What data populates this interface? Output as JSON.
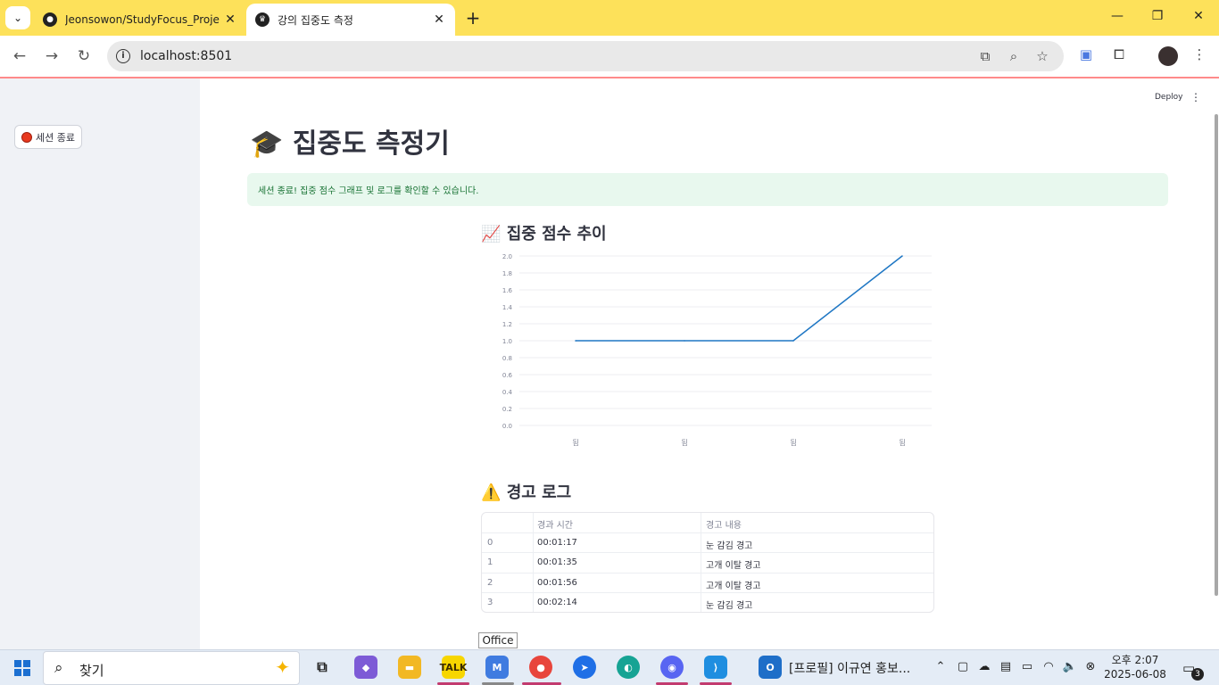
{
  "browser": {
    "tabs": [
      {
        "title": "Jeonsowon/StudyFocus_Project",
        "favicon": "github-icon"
      },
      {
        "title": "강의 집중도 측정",
        "favicon": "streamlit-crown-icon"
      }
    ],
    "url": "localhost:8501"
  },
  "app": {
    "sidebar": {
      "end_session_label": "세션 종료"
    },
    "header": {
      "deploy_label": "Deploy"
    },
    "title": "집중도 측정기",
    "title_icon": "graduation-cap",
    "success_message": "세션 종료! 집중 점수 그래프 및 로그를 확인할 수 있습니다.",
    "chart_heading": "집중 점수 추이",
    "chart_icon": "chart-increasing",
    "log_heading": "경고 로그",
    "log_icon": "warning",
    "table": {
      "columns": [
        "",
        "경과 시간",
        "경고 내용"
      ],
      "rows": [
        {
          "index": "0",
          "time": "00:01:17",
          "warning": "눈 감김 경고"
        },
        {
          "index": "1",
          "time": "00:01:35",
          "warning": "고개 이탈 경고"
        },
        {
          "index": "2",
          "time": "00:01:56",
          "warning": "고개 이탈 경고"
        },
        {
          "index": "3",
          "time": "00:02:14",
          "warning": "눈 감김 경고"
        }
      ]
    }
  },
  "chart_data": {
    "type": "line",
    "x_tick_labels": [
      "됨",
      "됨",
      "됨",
      "됨"
    ],
    "y_ticks": [
      "0.0",
      "0.2",
      "0.4",
      "0.6",
      "0.8",
      "1.0",
      "1.2",
      "1.4",
      "1.6",
      "1.8",
      "2.0"
    ],
    "ylim": [
      0,
      2
    ],
    "series": [
      {
        "values": [
          1,
          1,
          1,
          2
        ],
        "color": "#1f77c4"
      }
    ],
    "grid": true
  },
  "tooltip": "Office",
  "taskbar": {
    "search_text": "찾기",
    "window_title": "[프로필] 이규연 홍보...",
    "time": "오후 2:07",
    "date": "2025-06-08",
    "notification_count": "3"
  },
  "colors": {
    "accent": "#ff4b4b",
    "success_bg": "#e8f8ee",
    "success_text": "#177233",
    "chrome_bar": "#fde15a"
  }
}
